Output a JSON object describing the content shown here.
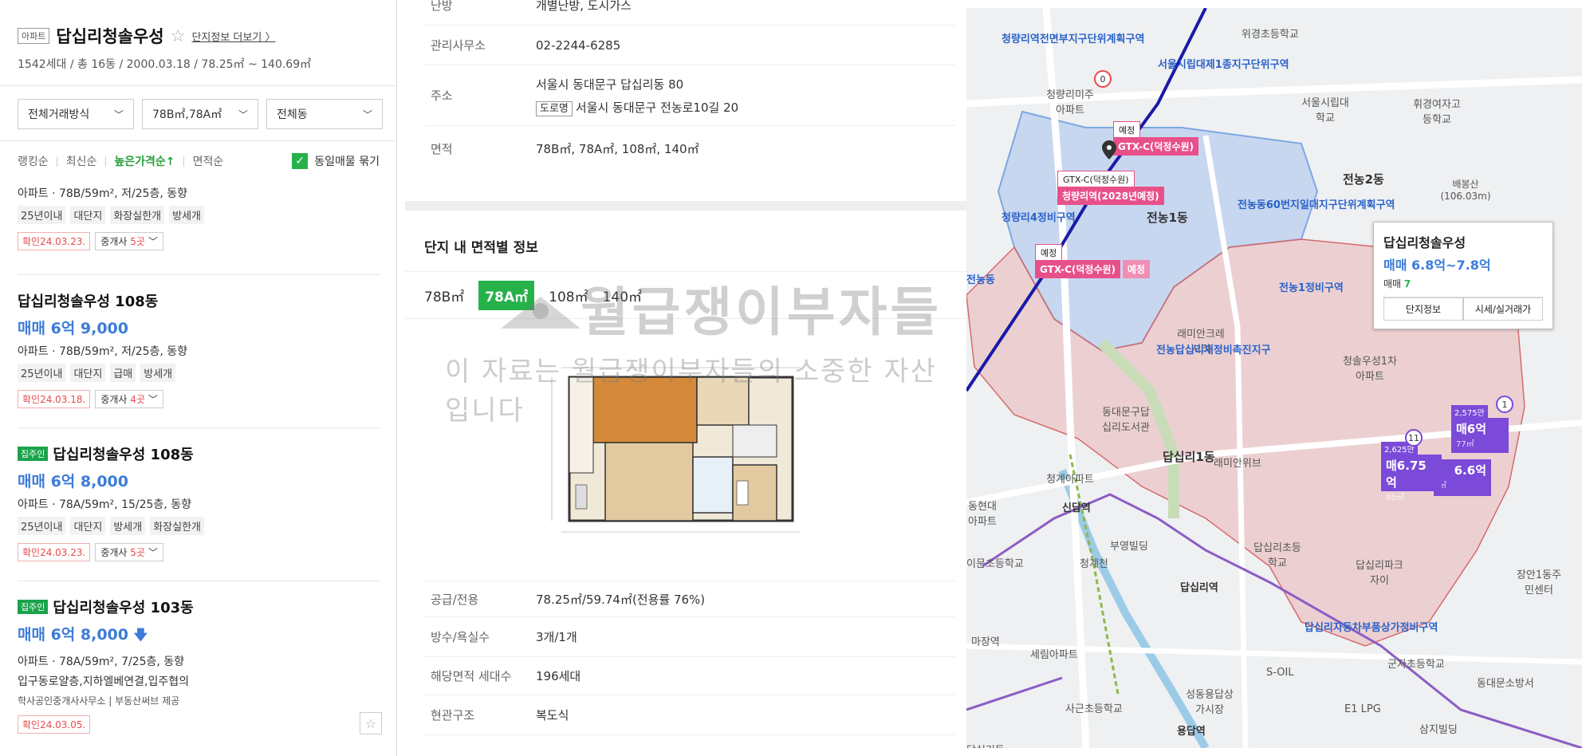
{
  "complex": {
    "badge": "아파트",
    "name": "답십리청솔우성",
    "more_link": "단지정보 더보기 〉",
    "summary": "1542세대 / 총 16동 / 2000.03.18 / 78.25㎡ ~ 140.69㎡"
  },
  "filters": {
    "trade_type": "전체거래방식",
    "area": "78B㎡,78A㎡",
    "dong": "전체동"
  },
  "sort": {
    "ranking": "랭킹순",
    "latest": "최신순",
    "price_high": "높은가격순↑",
    "area": "면적순",
    "group_label": "동일매물 묶기"
  },
  "listings": [
    {
      "title": "",
      "price": "",
      "spec": "아파트 · 78B/59m², 저/25층, 동향",
      "tags": [
        "25년이내",
        "대단지",
        "화장실한개",
        "방세개"
      ],
      "confirm": "확인24.03.23.",
      "brokers_label": "중개사",
      "brokers_count": "5곳"
    },
    {
      "title": "답십리청솔우성 108동",
      "price": "매매 6억 9,000",
      "spec": "아파트 · 78B/59m², 저/25층, 동향",
      "tags": [
        "25년이내",
        "대단지",
        "급매",
        "방세개"
      ],
      "confirm": "확인24.03.18.",
      "brokers_label": "중개사",
      "brokers_count": "4곳"
    },
    {
      "owner_badge": "집주인",
      "title": "답십리청솔우성 108동",
      "price": "매매 6억 8,000",
      "spec": "아파트 · 78A/59m², 15/25층, 동향",
      "tags": [
        "25년이내",
        "대단지",
        "방세개",
        "화장실한개"
      ],
      "confirm": "확인24.03.23.",
      "brokers_label": "중개사",
      "brokers_count": "5곳"
    },
    {
      "owner_badge": "집주인",
      "title": "답십리청솔우성 103동",
      "price": "매매 6억 8,000",
      "price_arrow": "🡇",
      "spec": "아파트 · 78A/59m², 7/25층, 동향",
      "desc": "입구동로얄층,지하엘베연결,입주협의",
      "agency": "학사공인중개사사무소 | 부동산써브 제공",
      "confirm": "확인24.03.05."
    }
  ],
  "info": {
    "office_label": "관리사무소",
    "office_value": "02-2244-6285",
    "addr_label": "주소",
    "addr_value": "서울시 동대문구 답십리동 80",
    "road_badge": "도로명",
    "road_value": "서울시 동대문구 전농로10길 20",
    "area_label": "면적",
    "area_value": "78B㎡, 78A㎡, 108㎡, 140㎡",
    "top_cut_label": "난방",
    "top_cut_value": "개별난방, 도시가스"
  },
  "area_section": {
    "title": "단지 내 면적별 정보",
    "tabs": [
      "78B㎡",
      "78A㎡",
      "108㎡",
      "140㎡"
    ],
    "active_tab": "78A㎡"
  },
  "detail": [
    {
      "k": "공급/전용",
      "v": "78.25㎡/59.74㎡(전용률 76%)"
    },
    {
      "k": "방수/욕실수",
      "v": "3개/1개"
    },
    {
      "k": "해당면적 세대수",
      "v": "196세대"
    },
    {
      "k": "현관구조",
      "v": "복도식"
    }
  ],
  "watermark": {
    "line1": "월급쟁이부자들",
    "line2": "이 자료는 월급쟁이부자들의 소중한 자산입니다"
  },
  "map": {
    "popup": {
      "title": "답십리청솔우성",
      "price": "매매 6.8억~7.8억",
      "count_label": "매매",
      "count": "7",
      "btn1": "단지정보",
      "btn2": "시세/실거래가"
    },
    "labels": {
      "l1": "청량리역전면부지구단위계획구역",
      "l2": "서울시립대제1종지구단위구역",
      "l3": "위경초등학교",
      "l4": "서울시립대학교",
      "l5": "휘경여자고등학교",
      "l6": "청량리미주아파트",
      "l7": "전농2동",
      "l8": "배봉산 (106.03m)",
      "l9": "전농동60번지일대지구단위계획구역",
      "l10": "청량리4정비구역",
      "l11": "전농1동",
      "l12": "전농1정비구역",
      "l13": "래미안크레시티",
      "l14": "전농답십리재정비촉진지구",
      "l15": "청솔우성1차아파트",
      "l16": "동대문구답십리도서관",
      "l17": "답십리1동",
      "l18": "래미안위브",
      "l19": "신답역",
      "l20": "청계천",
      "l21": "답십리역",
      "l22": "답십리초등학교",
      "l23": "답십리파크자이",
      "l24": "답십리자동차부품상가정비구역",
      "l25": "군자초등학교",
      "l26": "장안1동주민센터",
      "l27": "S-OIL",
      "l28": "성동용답상가시장",
      "l29": "사근초등학교",
      "l30": "용답역",
      "l31": "E1 LPG",
      "l32": "삼지빌딩",
      "l33": "동대문소방서",
      "l34": "세림아파트",
      "l35": "마장역",
      "l36": "부영빌딩",
      "l37": "청계아파트",
      "l38": "동현대아파트",
      "l39": "이문초등학교",
      "l40": "전농동",
      "l41": "답십리동"
    },
    "gtx": {
      "a_top": "예정",
      "a": "GTX-C(덕정수원)",
      "b_top": "GTX-C(덕정수원)",
      "b": "청량리역(2028년예정)",
      "c_top": "예정",
      "c": "GTX-C(덕정수원)",
      "d": "예정"
    },
    "markers": [
      {
        "top": "2,575만",
        "big": "매6억",
        "small": "77㎡"
      },
      {
        "top": "2,625만",
        "big": "매6.75억",
        "small": "85㎡"
      },
      {
        "big": "6.6억",
        "small": "㎡"
      }
    ],
    "bubbles": [
      "11",
      "1",
      "0"
    ]
  },
  "colors": {
    "green": "#26b24b",
    "blue": "#3c7cd8",
    "red": "#e74b4b",
    "purple": "#7b4ad8",
    "gtx_pink": "#e8508a"
  }
}
